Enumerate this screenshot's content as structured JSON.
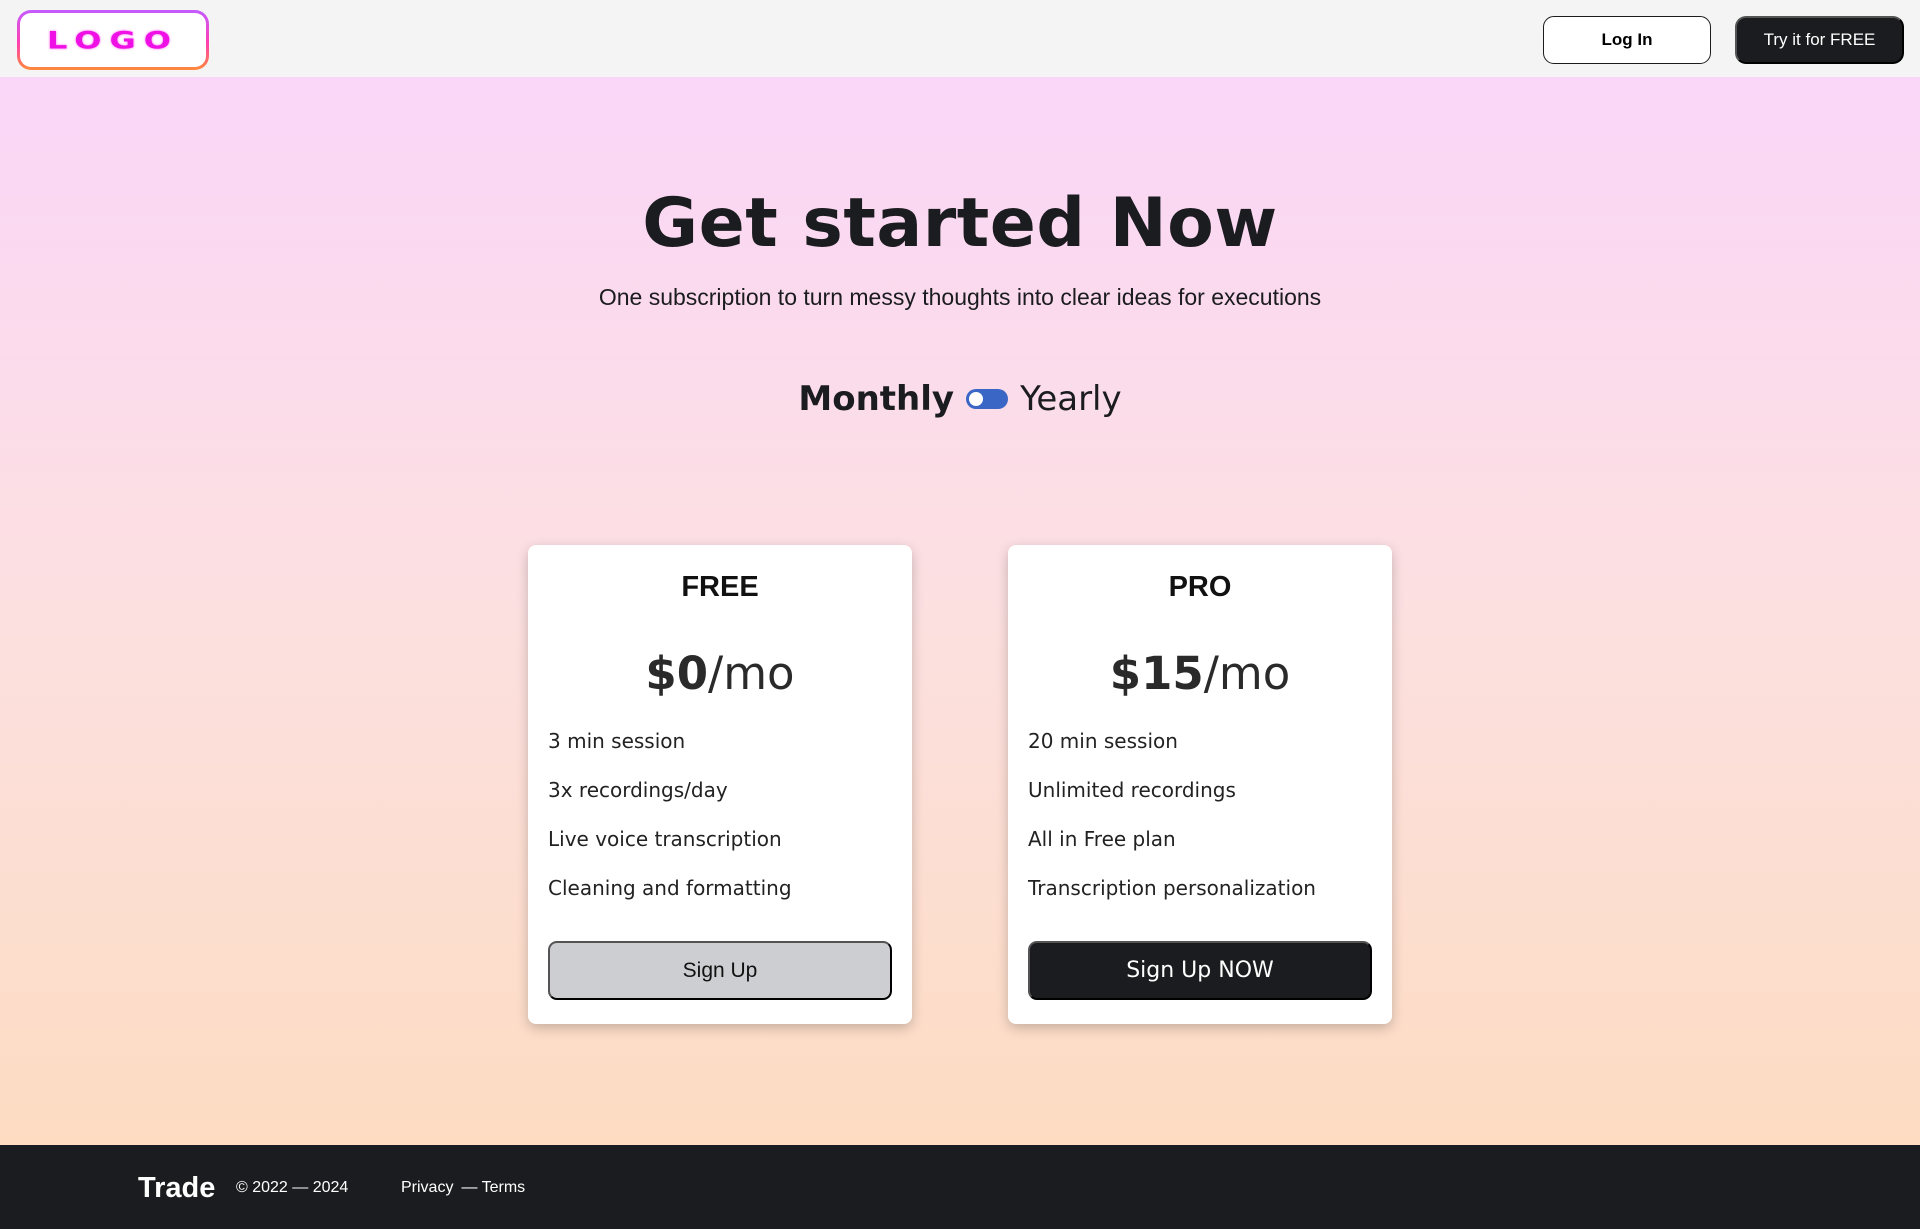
{
  "header": {
    "logo_text": "LOGO",
    "login_label": "Log In",
    "try_label": "Try it for FREE"
  },
  "hero": {
    "title": "Get started Now",
    "subtitle": "One subscription to turn messy thoughts into clear ideas for executions",
    "billing": {
      "monthly_label": "Monthly",
      "yearly_label": "Yearly",
      "selected": "Monthly"
    }
  },
  "plans": [
    {
      "name": "FREE",
      "price_amount": "$0",
      "price_period": "/mo",
      "features": [
        "3 min session",
        "3x recordings/day",
        "Live voice transcription",
        "Cleaning and formatting"
      ],
      "cta_label": "Sign Up"
    },
    {
      "name": "PRO",
      "price_amount": "$15",
      "price_period": "/mo",
      "features": [
        "20 min session",
        "Unlimited recordings",
        "All in Free plan",
        "Transcription personalization"
      ],
      "cta_label": "Sign Up NOW"
    }
  ],
  "footer": {
    "brand": "Trade",
    "copyright": "© 2022 — 2024",
    "privacy_label": "Privacy",
    "terms_label": "— Terms"
  },
  "colors": {
    "accent": "#3a67c5",
    "dark": "#1b1c1f",
    "logo": "#ee10e4"
  }
}
